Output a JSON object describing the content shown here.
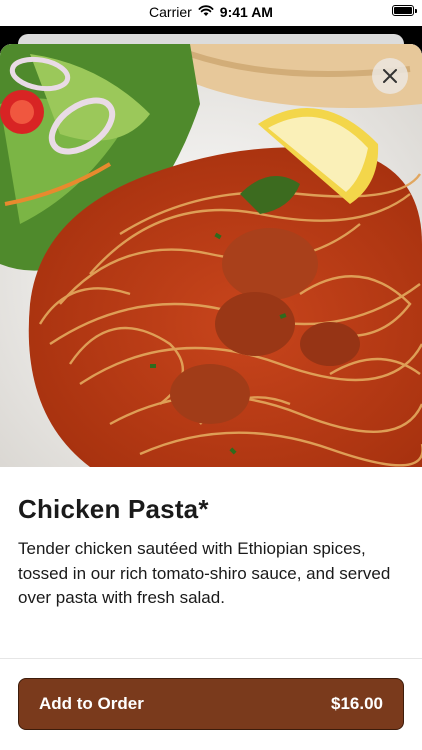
{
  "status_bar": {
    "carrier": "Carrier",
    "time": "9:41 AM"
  },
  "item": {
    "name": "Chicken Pasta*",
    "description": "Tender chicken sautéed with Ethiopian spices, tossed in our rich tomato-shiro sauce, and served over pasta with fresh salad.",
    "photo_subject": "spaghetti with chicken, lemon wedge and salad"
  },
  "actions": {
    "add_to_order_label": "Add to Order",
    "price": "$16.00",
    "close_icon": "close-icon"
  },
  "colors": {
    "accent": "#7a3a1c",
    "accent_border": "#3d1c0b",
    "text": "#1a1a1a"
  }
}
